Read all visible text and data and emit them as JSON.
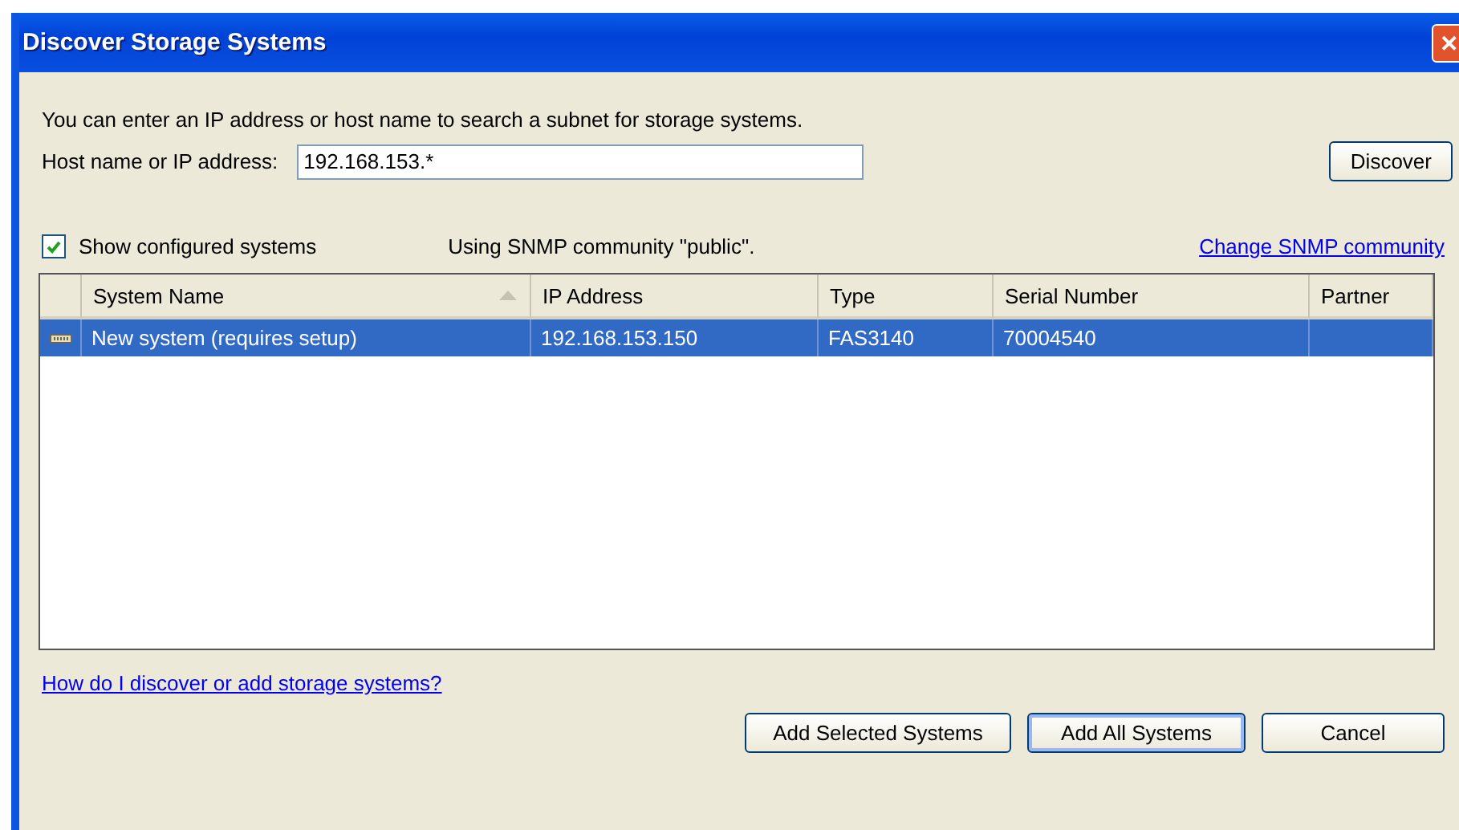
{
  "window": {
    "title": "Discover Storage Systems",
    "close": "✕"
  },
  "intro": "You can enter an IP address or host name to search a subnet for storage systems.",
  "host": {
    "label": "Host name or IP address:",
    "value": "192.168.153.*"
  },
  "discover_button": "Discover",
  "show_configured": {
    "label": "Show configured systems",
    "checked": true
  },
  "snmp_note": "Using SNMP community \"public\".",
  "change_snmp_link": "Change SNMP community",
  "table": {
    "columns": [
      {
        "label": "System Name",
        "sorted": true
      },
      {
        "label": "IP Address",
        "sorted": false
      },
      {
        "label": "Type",
        "sorted": false
      },
      {
        "label": "Serial Number",
        "sorted": false
      },
      {
        "label": "Partner",
        "sorted": false
      }
    ],
    "rows": [
      {
        "selected": true,
        "cells": [
          "New system (requires setup)",
          "192.168.153.150",
          "FAS3140",
          "70004540",
          ""
        ]
      }
    ]
  },
  "help_link": "How do I discover or add storage systems?",
  "buttons": [
    {
      "label": "Add Selected Systems",
      "default": false
    },
    {
      "label": "Add All Systems",
      "default": true
    },
    {
      "label": "Cancel",
      "default": false
    }
  ]
}
